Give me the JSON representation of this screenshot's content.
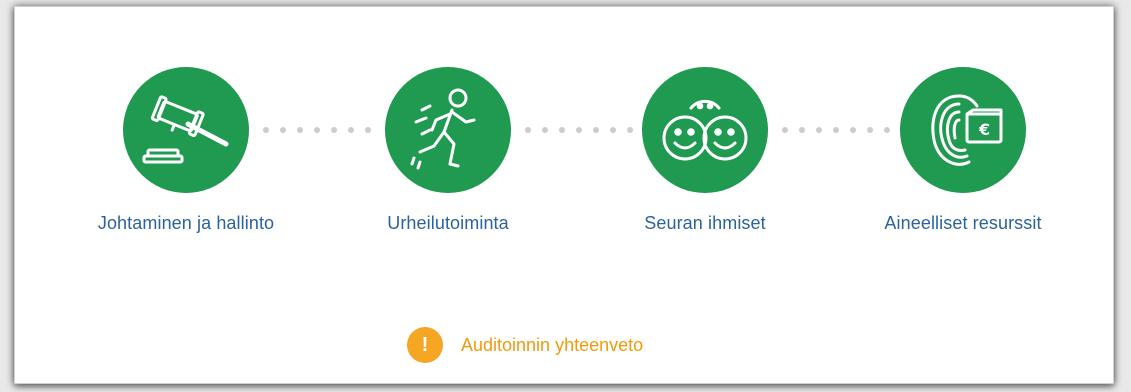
{
  "steps": [
    {
      "label": "Johtaminen ja hallinto",
      "icon": "gavel-icon"
    },
    {
      "label": "Urheilutoiminta",
      "icon": "runner-icon"
    },
    {
      "label": "Seuran ihmiset",
      "icon": "smiley-faces-icon"
    },
    {
      "label": "Aineelliset resurssit",
      "icon": "fingerprint-money-icon"
    }
  ],
  "summary": {
    "badge": "!",
    "label": "Auditoinnin yhteenveto",
    "icon": "warning-icon"
  },
  "colors": {
    "step_circle": "#1f9a50",
    "step_label": "#2b62a1",
    "connector_dot": "#c8cdd2",
    "summary_badge": "#f5a623",
    "summary_label": "#f29a0c"
  }
}
